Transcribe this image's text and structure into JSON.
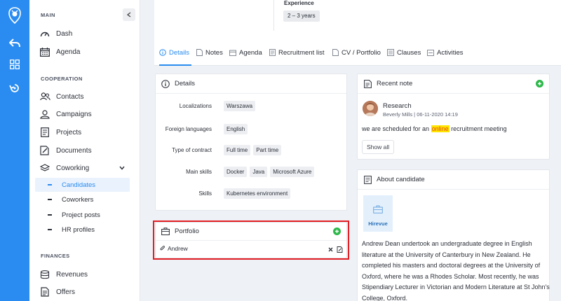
{
  "sidebar": {
    "sections": {
      "main": "MAIN",
      "cooperation": "COOPERATION",
      "finances": "FINANCES"
    },
    "main_items": [
      {
        "label": "Dash",
        "icon": "gauge-icon"
      },
      {
        "label": "Agenda",
        "icon": "calendar-icon"
      }
    ],
    "coop_items": [
      {
        "label": "Contacts",
        "icon": "contacts-icon"
      },
      {
        "label": "Campaigns",
        "icon": "campaigns-icon"
      },
      {
        "label": "Projects",
        "icon": "projects-icon"
      },
      {
        "label": "Documents",
        "icon": "documents-icon"
      },
      {
        "label": "Coworking",
        "icon": "layers-icon"
      }
    ],
    "coworking_sub": [
      "Candidates",
      "Coworkers",
      "Project posts",
      "HR profiles"
    ],
    "finance_items": [
      {
        "label": "Revenues",
        "icon": "revenues-icon"
      },
      {
        "label": "Offers",
        "icon": "offers-icon"
      }
    ]
  },
  "top": {
    "experience_label": "Experience",
    "experience_value": "2 – 3 years"
  },
  "tabs": [
    "Details",
    "Notes",
    "Agenda",
    "Recruitment list",
    "CV / Portfolio",
    "Clauses",
    "Activities"
  ],
  "details": {
    "title": "Details",
    "rows": [
      {
        "label": "Localizations",
        "values": [
          "Warszawa"
        ]
      },
      {
        "label": "Foreign languages",
        "values": [
          "English"
        ]
      },
      {
        "label": "Type of contract",
        "values": [
          "Full time",
          "Part time"
        ]
      },
      {
        "label": "Main skills",
        "values": [
          "Docker",
          "Java",
          "Microsoft Azure"
        ]
      },
      {
        "label": "Skills",
        "values": [
          "Kubernetes environment"
        ]
      }
    ]
  },
  "portfolio": {
    "title": "Portfolio",
    "item": "Andrew"
  },
  "recent_note": {
    "title": "Recent note",
    "note_title": "Research",
    "meta": "Beverly Mills | 06-11-2020 14:19",
    "text_before": "we are scheduled for an ",
    "text_highlight": "online",
    "text_after": " recruitment meeting",
    "show_all": "Show all"
  },
  "about": {
    "title": "About candidate",
    "badge": "Hirevue",
    "text": "Andrew Dean undertook an undergraduate degree in English literature at the University of Canterbury in New Zealand. He completed his masters and doctoral degrees at the University of Oxford, where he was a Rhodes Scholar. Most recently, he was Stipendiary Lecturer in Victorian and Modern Literature at St John's College, Oxford."
  },
  "colors": {
    "accent": "#2a8cf0",
    "add": "#2eb84b",
    "highlight_border": "#e31e24"
  }
}
